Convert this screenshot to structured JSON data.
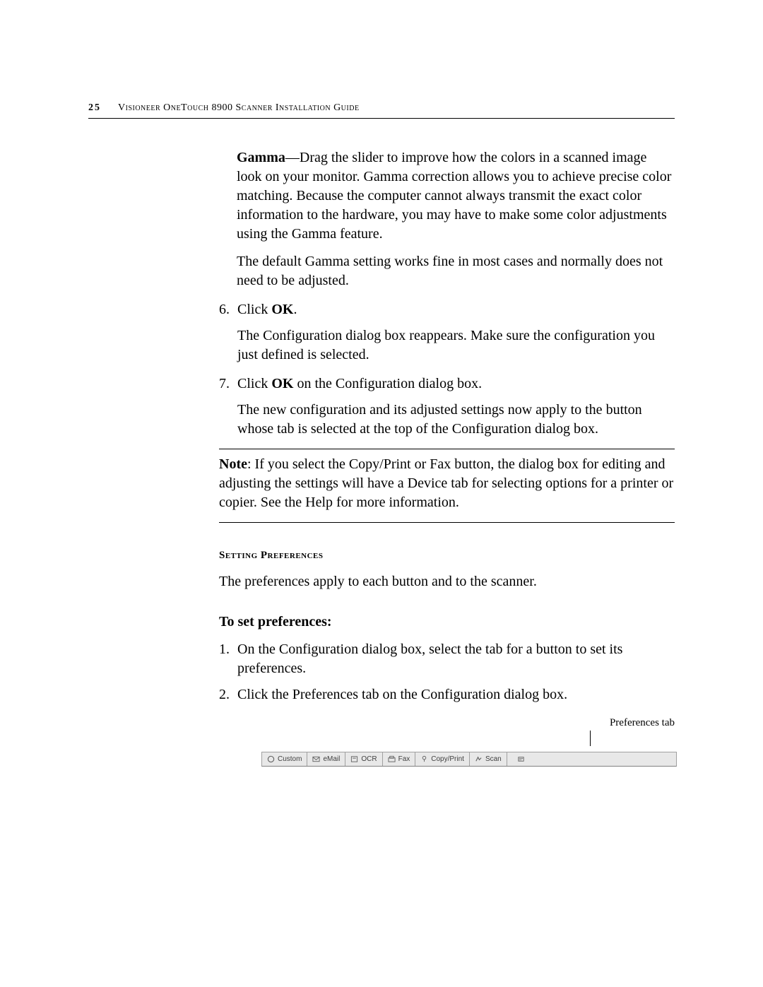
{
  "header": {
    "page_number": "25",
    "guide_title": "Visioneer OneTouch 8900 Scanner Installation Guide"
  },
  "gamma": {
    "label": "Gamma",
    "desc": "—Drag the slider to improve how the colors in a scanned image look on your monitor. Gamma correction allows you to achieve precise color matching. Because the computer cannot always transmit the exact color information to the hardware, you may have to make some color adjustments using the Gamma feature.",
    "default_note": "The default Gamma setting works fine in most cases and normally does not need to be adjusted."
  },
  "steps_a": {
    "s6": {
      "num": "6.",
      "pre": "Click ",
      "bold": "OK",
      "post": "."
    },
    "s6_follow": "The Configuration dialog box reappears. Make sure the configuration you just defined is selected.",
    "s7": {
      "num": "7.",
      "pre": "Click ",
      "bold": "OK",
      "post": " on the Configuration dialog box."
    },
    "s7_follow": "The new configuration and its adjusted settings now apply to the button whose tab is selected at the top of the Configuration dialog box."
  },
  "note": {
    "label": "Note",
    "text": ":  If you select the Copy/Print or Fax button, the dialog box for editing and adjusting the settings will have a Device tab for selecting options for a printer or copier. See the Help for more information."
  },
  "prefs": {
    "heading": "Setting Preferences",
    "intro": "The preferences apply to each button and to the scanner.",
    "subhead": "To set preferences:",
    "s1": {
      "num": "1.",
      "text": "On the Configuration dialog box, select the tab for a button to set its preferences."
    },
    "s2": {
      "num": "2.",
      "text": "Click the Preferences tab on the Configuration dialog box."
    }
  },
  "fig": {
    "caption": "Preferences tab",
    "tabs": {
      "custom": "Custom",
      "email": "eMail",
      "ocr": "OCR",
      "fax": "Fax",
      "copy": "Copy/Print",
      "scan": "Scan"
    }
  }
}
